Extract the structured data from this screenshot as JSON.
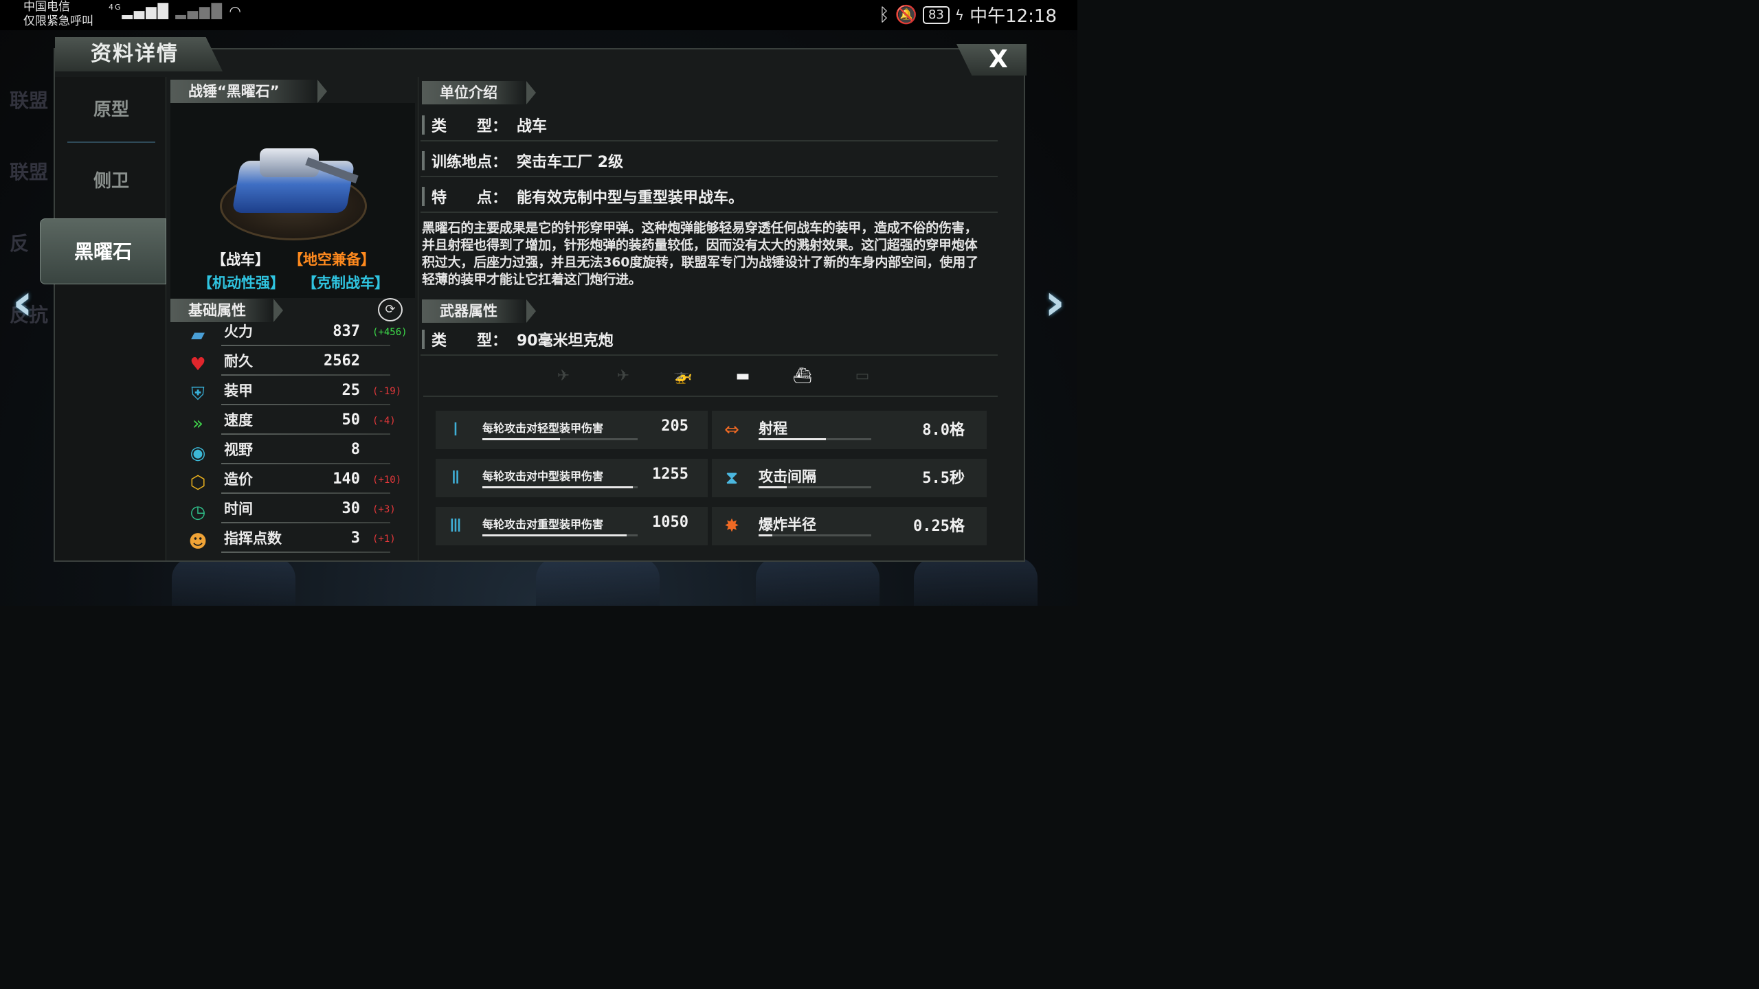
{
  "status_bar": {
    "carrier": "中国电信",
    "emergency": "仅限紧急呼叫",
    "network": "4G",
    "battery": "83",
    "time": "中午12:18"
  },
  "background_sidebar": [
    "联盟",
    "联盟",
    "反",
    "反抗"
  ],
  "dialog": {
    "title": "资料详情",
    "close_label": "X"
  },
  "nav": {
    "items": [
      "原型",
      "侧卫",
      "黑曜石"
    ],
    "active": "黑曜石"
  },
  "unit": {
    "name": "战锤“黑曜石”",
    "tags": [
      {
        "text": "【战车】",
        "color": "#f2f2f2"
      },
      {
        "text": "【地空兼备】",
        "color": "#ff8a1e"
      },
      {
        "text": "【机动性强】",
        "color": "#2fc4e0"
      },
      {
        "text": "【克制战车】",
        "color": "#2fc4e0"
      }
    ]
  },
  "base_stats": {
    "header": "基础属性",
    "refresh_icon": "refresh-icon",
    "rows": [
      {
        "icon": "firepower-icon",
        "glyph": "▰",
        "color": "#4a9fd6",
        "label": "火力",
        "value": "837",
        "delta": "(+456)",
        "delta_type": "pos"
      },
      {
        "icon": "durability-heart-icon",
        "glyph": "♥",
        "color": "#e0262c",
        "label": "耐久",
        "value": "2562",
        "delta": "",
        "delta_type": ""
      },
      {
        "icon": "armor-shield-icon",
        "glyph": "⛨",
        "color": "#38b0d8",
        "label": "装甲",
        "value": "25",
        "delta": "(-19)",
        "delta_type": "neg"
      },
      {
        "icon": "speed-chevron-icon",
        "glyph": "»",
        "color": "#3fd04a",
        "label": "速度",
        "value": "50",
        "delta": "(-4)",
        "delta_type": "neg"
      },
      {
        "icon": "vision-eye-icon",
        "glyph": "◉",
        "color": "#3cb8d6",
        "label": "视野",
        "value": "8",
        "delta": "",
        "delta_type": ""
      },
      {
        "icon": "cost-cube-icon",
        "glyph": "⬡",
        "color": "#f0b51e",
        "label": "造价",
        "value": "140",
        "delta": "(+10)",
        "delta_type": "neg"
      },
      {
        "icon": "time-clock-icon",
        "glyph": "◷",
        "color": "#2fbf8a",
        "label": "时间",
        "value": "30",
        "delta": "(+3)",
        "delta_type": "neg"
      },
      {
        "icon": "command-points-icon",
        "glyph": "☻",
        "color": "#f0a336",
        "label": "指挥点数",
        "value": "3",
        "delta": "(+1)",
        "delta_type": "neg"
      }
    ]
  },
  "intro": {
    "header": "单位介绍",
    "rows": [
      {
        "key": "类　　型：",
        "value": "战车"
      },
      {
        "key": "训练地点：",
        "value": "突击车工厂  2级"
      },
      {
        "key": "特　　点：",
        "value": "能有效克制中型与重型装甲战车。"
      }
    ],
    "description": "黑曜石的主要成果是它的针形穿甲弹。这种炮弹能够轻易穿透任何战车的装甲，造成不俗的伤害，并且射程也得到了增加，针形炮弹的装药量较低，因而没有太大的溅射效果。这门超强的穿甲炮体积过大，后座力过强，并且无法360度旋转，联盟军专门为战锤设计了新的车身内部空间，使用了轻薄的装甲才能让它扛着这门炮行进。"
  },
  "weapon": {
    "header": "武器属性",
    "type_key": "类　　型：",
    "type_value": "90毫米坦克炮",
    "targets": [
      {
        "icon": "fighter-jet-icon",
        "glyph": "✈",
        "active": false
      },
      {
        "icon": "bomber-plane-icon",
        "glyph": "✈",
        "active": false
      },
      {
        "icon": "helicopter-icon",
        "glyph": "🚁",
        "active": false
      },
      {
        "icon": "tank-icon",
        "glyph": "▬",
        "active": true
      },
      {
        "icon": "ship-icon",
        "glyph": "⛴",
        "active": true
      },
      {
        "icon": "submarine-icon",
        "glyph": "▭",
        "active": false
      }
    ],
    "stats": [
      {
        "icon": "light-armor-damage-icon",
        "glyph": "Ⅰ",
        "label": "每轮攻击对轻型装甲伤害",
        "value": "205",
        "bar": 0.5
      },
      {
        "icon": "range-arrows-icon",
        "glyph": "⇔",
        "label": "射程",
        "value": "8.0格",
        "bar": 0.6
      },
      {
        "icon": "medium-armor-damage-icon",
        "glyph": "Ⅱ",
        "label": "每轮攻击对中型装甲伤害",
        "value": "1255",
        "bar": 0.97
      },
      {
        "icon": "hourglass-icon",
        "glyph": "⧗",
        "label": "攻击间隔",
        "value": "5.5秒",
        "bar": 0.25
      },
      {
        "icon": "heavy-armor-damage-icon",
        "glyph": "Ⅲ",
        "label": "每轮攻击对重型装甲伤害",
        "value": "1050",
        "bar": 0.93
      },
      {
        "icon": "explosion-icon",
        "glyph": "✸",
        "label": "爆炸半径",
        "value": "0.25格",
        "bar": 0.12
      }
    ]
  },
  "arrows": {
    "prev": "‹",
    "next": "›"
  }
}
